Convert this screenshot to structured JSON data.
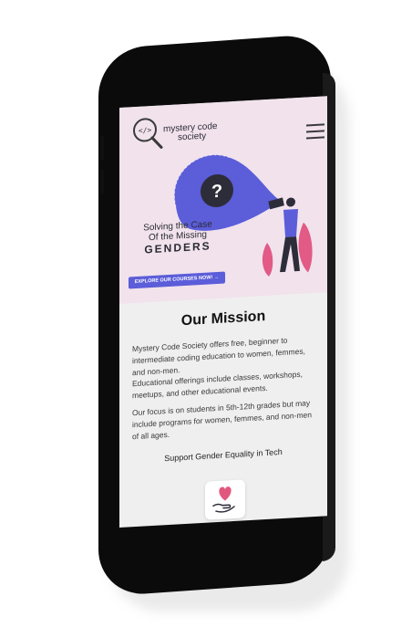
{
  "brand": {
    "name_line1": "mystery code",
    "name_line2": "society",
    "accent": "#5b5dd9",
    "hero_bg": "#f1e2ec",
    "section_bg": "#f0efef"
  },
  "header": {
    "menu_icon": "hamburger-menu-icon"
  },
  "hero": {
    "tagline_line1": "Solving the Case",
    "tagline_line2": "Of the Missing",
    "tagline_big": "GENDERS",
    "cta_label": "EXPLORE OUR COURSES NOW! →",
    "illustration_icon": "question-mark-spotlight-icon"
  },
  "mission": {
    "title": "Our Mission",
    "paragraph1": "Mystery Code Society offers free, beginner to intermediate coding education to women, femmes, and non-men.",
    "paragraph2": "Educational offerings include classes, workshops, meetups, and other educational events.",
    "paragraph3": "Our focus is on students in 5th-12th grades but may include programs for women, femmes, and non-men of all ages.",
    "support_heading": "Support Gender Equality in Tech",
    "donate_icon": "heart-hand-icon"
  }
}
